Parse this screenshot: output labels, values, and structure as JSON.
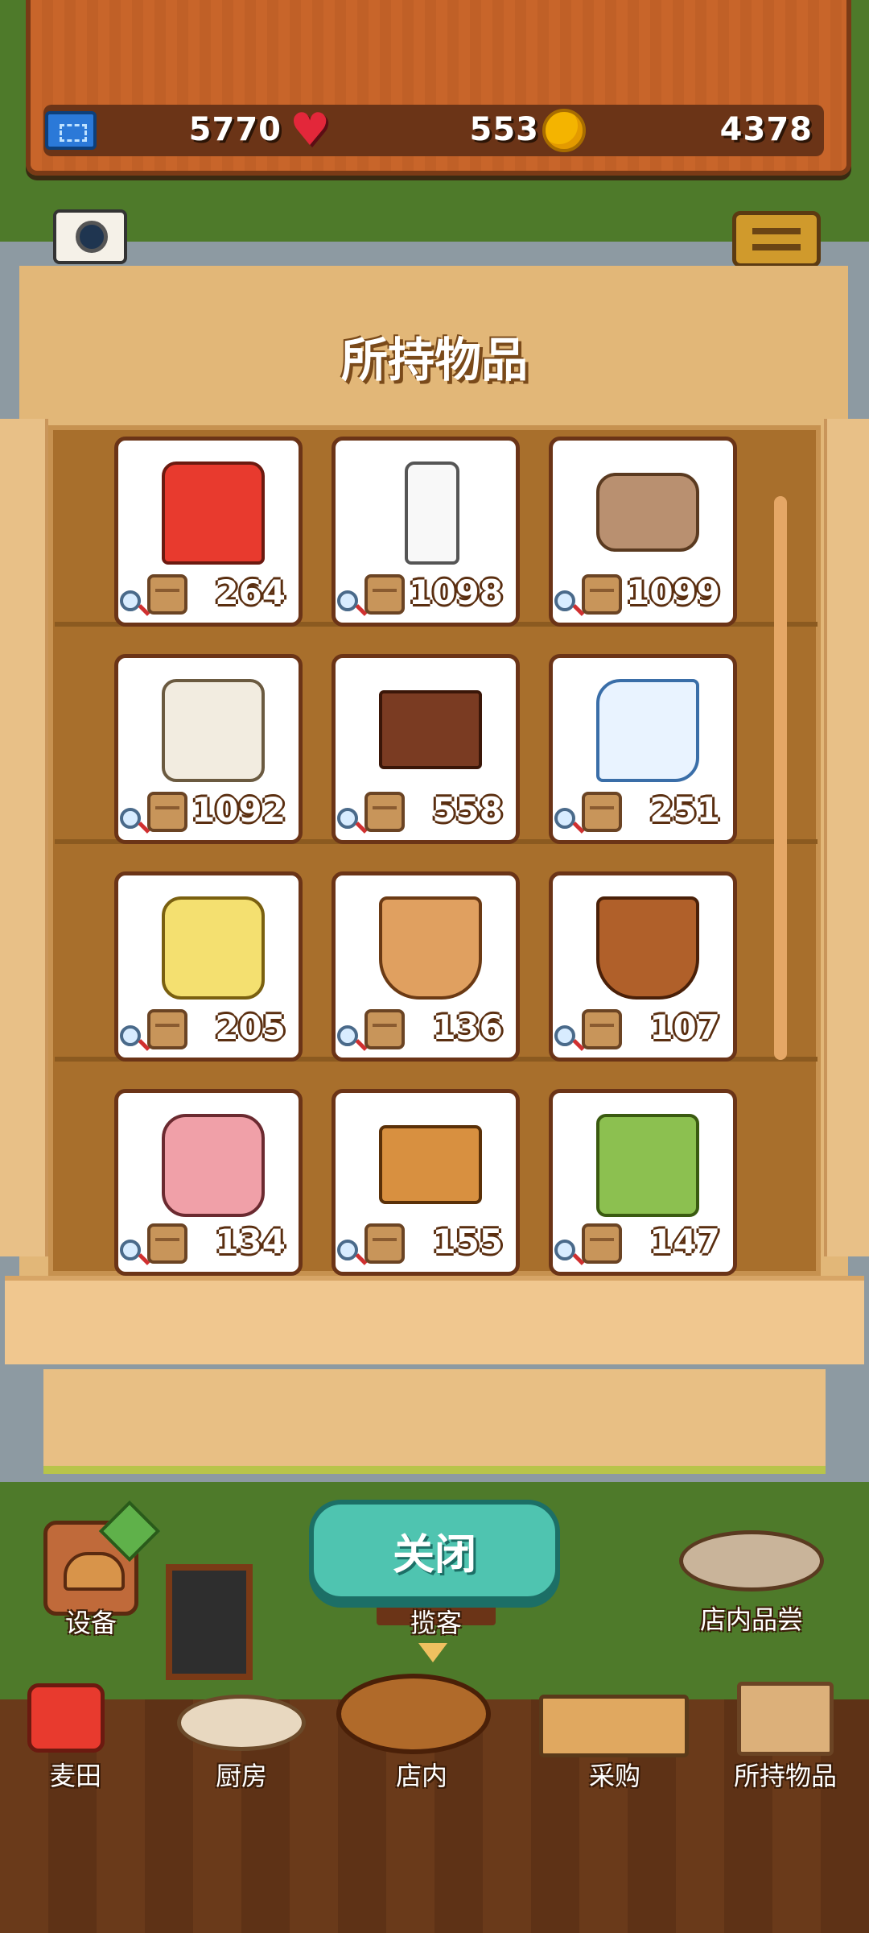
{
  "stats": {
    "tickets": "5770",
    "hearts": "553",
    "coins": "4378"
  },
  "camera": {
    "label": "照相"
  },
  "panel": {
    "title": "所持物品"
  },
  "items": [
    {
      "icon": "flour-bag-icon",
      "count": "264"
    },
    {
      "icon": "milk-bottle-icon",
      "count": "1098"
    },
    {
      "icon": "egg-sack-icon",
      "count": "1099"
    },
    {
      "icon": "sugar-jar-icon",
      "count": "1092"
    },
    {
      "icon": "chocolate-bar-icon",
      "count": "558"
    },
    {
      "icon": "cream-icon",
      "count": "251"
    },
    {
      "icon": "cheese-butter-icon",
      "count": "205"
    },
    {
      "icon": "fruit-basket-icon",
      "count": "136"
    },
    {
      "icon": "vegetable-basket-icon",
      "count": "107"
    },
    {
      "icon": "meat-icon",
      "count": "134"
    },
    {
      "icon": "spices-icon",
      "count": "155"
    },
    {
      "icon": "oil-bottles-icon",
      "count": "147"
    }
  ],
  "close_button": {
    "label": "关闭"
  },
  "bottom_left": {
    "equipment_label": "设备"
  },
  "bottom_center": {
    "attract_label": "揽客"
  },
  "bottom_right": {
    "tasting_label": "店内品尝"
  },
  "nav": [
    {
      "label": "麦田",
      "icon": "wheat-field-icon"
    },
    {
      "label": "厨房",
      "icon": "kitchen-icon"
    },
    {
      "label": "店内",
      "icon": "store-icon"
    },
    {
      "label": "采购",
      "icon": "purchase-icon"
    },
    {
      "label": "所持物品",
      "icon": "inventory-box-icon"
    }
  ]
}
